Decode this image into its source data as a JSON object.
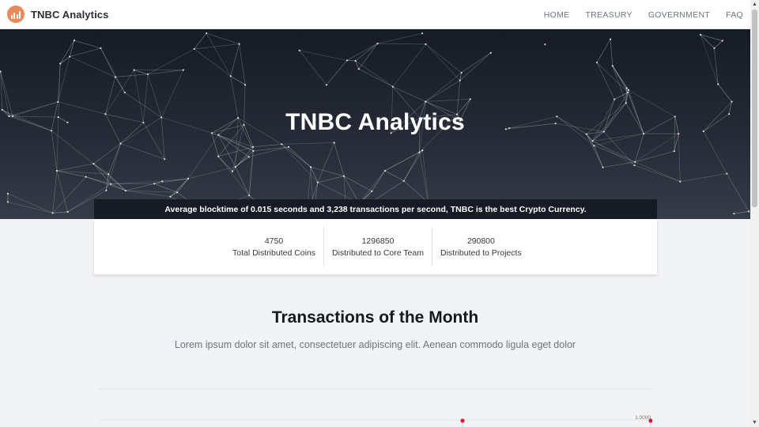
{
  "brand": {
    "name": "TNBC Analytics",
    "logo_color": "#e8895a"
  },
  "nav": {
    "links": [
      "HOME",
      "TREASURY",
      "GOVERNMENT",
      "FAQ"
    ]
  },
  "hero": {
    "title": "TNBC Analytics",
    "ticker": "Average blocktime of 0.015 seconds and 3,238 transactions per second, TNBC is the best Crypto Currency."
  },
  "stats": [
    {
      "value": "4750",
      "label": "Total Distributed Coins"
    },
    {
      "value": "1296850",
      "label": "Distributed to Core Team"
    },
    {
      "value": "290800",
      "label": "Distributed to Projects"
    }
  ],
  "section": {
    "title": "Transactions of the Month",
    "subtitle": "Lorem ipsum dolor sit amet, consectetuer adipiscing elit. Aenean commodo ligula eget dolor"
  },
  "chart_data": {
    "type": "line",
    "tick_labels": [
      "1.0000"
    ],
    "point_color": "#e0183c"
  },
  "colors": {
    "hero_dark": "#161b26",
    "accent": "#e8895a",
    "marker": "#e0183c"
  }
}
